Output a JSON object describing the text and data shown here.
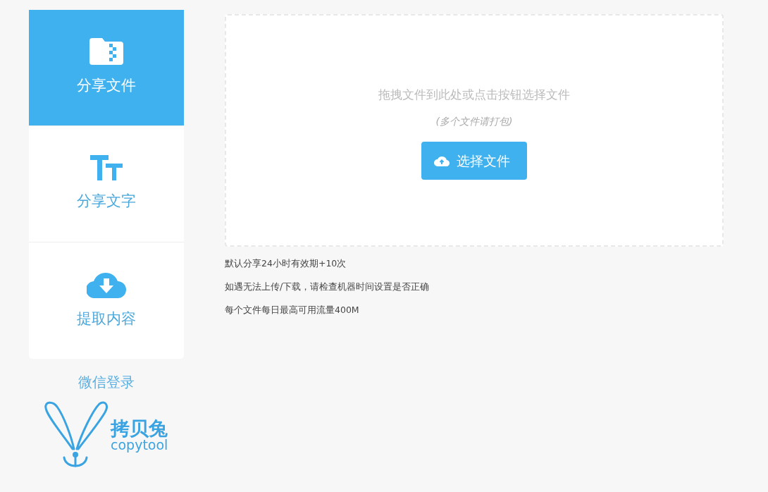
{
  "sidebar": {
    "items": [
      {
        "kind": "file",
        "label": "分享文件",
        "selected": true
      },
      {
        "kind": "text",
        "label": "分享文字",
        "selected": false
      },
      {
        "kind": "download",
        "label": "提取内容",
        "selected": false
      }
    ],
    "login_link": "微信登录",
    "logo": {
      "title": "拷贝兔",
      "subtitle": "copytool"
    }
  },
  "dropzone": {
    "hint": "拖拽文件到此处或点击按钮选择文件",
    "subhint": "(多个文件请打包)",
    "button": "选择文件"
  },
  "notes": [
    "默认分享24小时有效期+10次",
    "如遇无法上传/下载，请检查机器时间设置是否正确",
    "每个文件每日最高可用流量400M"
  ]
}
